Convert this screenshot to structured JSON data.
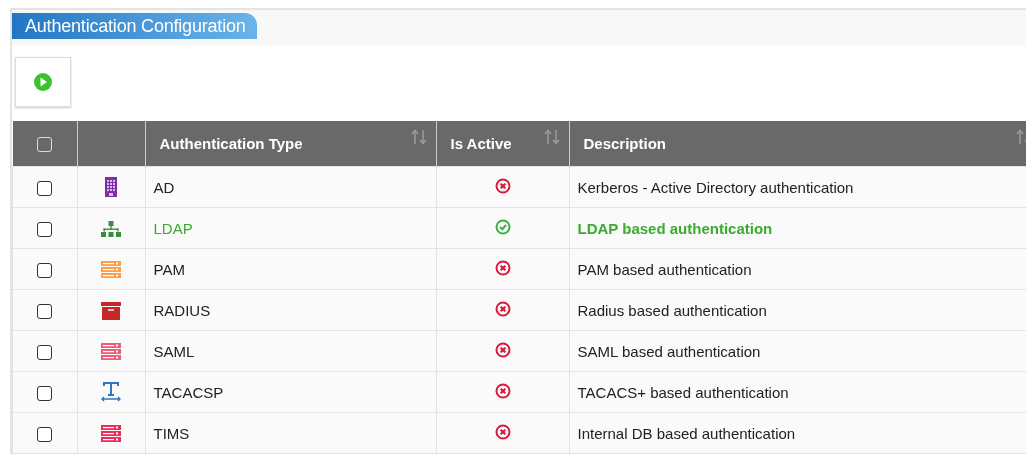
{
  "panel": {
    "title": "Authentication Configuration"
  },
  "toolbar": {
    "buttons": [
      {
        "kind": "run"
      }
    ]
  },
  "table": {
    "select_all": {
      "checked": false
    },
    "columns": [
      {
        "label": "Authentication Type",
        "sortable": true
      },
      {
        "label": "Is Active",
        "sortable": true
      },
      {
        "label": "Description",
        "sortable": true
      }
    ],
    "rows": [
      {
        "checked": false,
        "kind": "building",
        "type": "AD",
        "active": false,
        "description": "Kerberos - Active Directory authentication"
      },
      {
        "checked": false,
        "kind": "sitemap",
        "type": "LDAP",
        "active": true,
        "description": "LDAP based authentication"
      },
      {
        "checked": false,
        "kind": "server-orange",
        "type": "PAM",
        "active": false,
        "description": "PAM based authentication"
      },
      {
        "checked": false,
        "kind": "archive",
        "type": "RADIUS",
        "active": false,
        "description": "Radius based authentication"
      },
      {
        "checked": false,
        "kind": "server-pink",
        "type": "SAML",
        "active": false,
        "description": "SAML based authentication"
      },
      {
        "checked": false,
        "kind": "text-width",
        "type": "TACACSP",
        "active": false,
        "description": "TACACS+ based authentication"
      },
      {
        "checked": false,
        "kind": "server-red",
        "type": "TIMS",
        "active": false,
        "description": "Internal DB based authentication"
      }
    ]
  }
}
